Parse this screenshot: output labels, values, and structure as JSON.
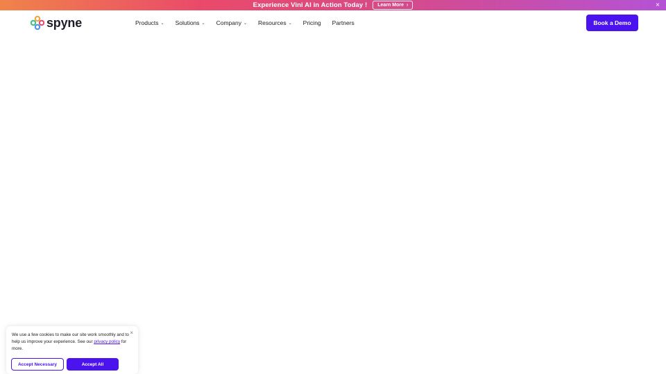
{
  "colors": {
    "accent": "#4b13ee",
    "banner_start": "#f0834a",
    "banner_end": "#b453d6"
  },
  "promo": {
    "text": "Experience Vini AI in Action Today !",
    "button_label": "Learn More",
    "button_icon": "chevron-right-icon",
    "close_icon": "close-icon",
    "close_glyph": "×",
    "chevron_glyph": "›"
  },
  "header": {
    "logo_text": "spyne",
    "nav": [
      {
        "label": "Products",
        "has_dropdown": true
      },
      {
        "label": "Solutions",
        "has_dropdown": true
      },
      {
        "label": "Company",
        "has_dropdown": true
      },
      {
        "label": "Resources",
        "has_dropdown": true
      },
      {
        "label": "Pricing",
        "has_dropdown": false
      },
      {
        "label": "Partners",
        "has_dropdown": false
      }
    ],
    "dropdown_glyph": "⌄",
    "cta_label": "Book a Demo"
  },
  "cookie": {
    "text_before": "We use a few cookies to make our site work smoothly and to help us improve your experience. See our ",
    "link_text": "privacy policy",
    "text_after": " for more.",
    "close_glyph": "×",
    "accept_necessary_label": "Accept Necessary",
    "accept_all_label": "Accept All"
  }
}
